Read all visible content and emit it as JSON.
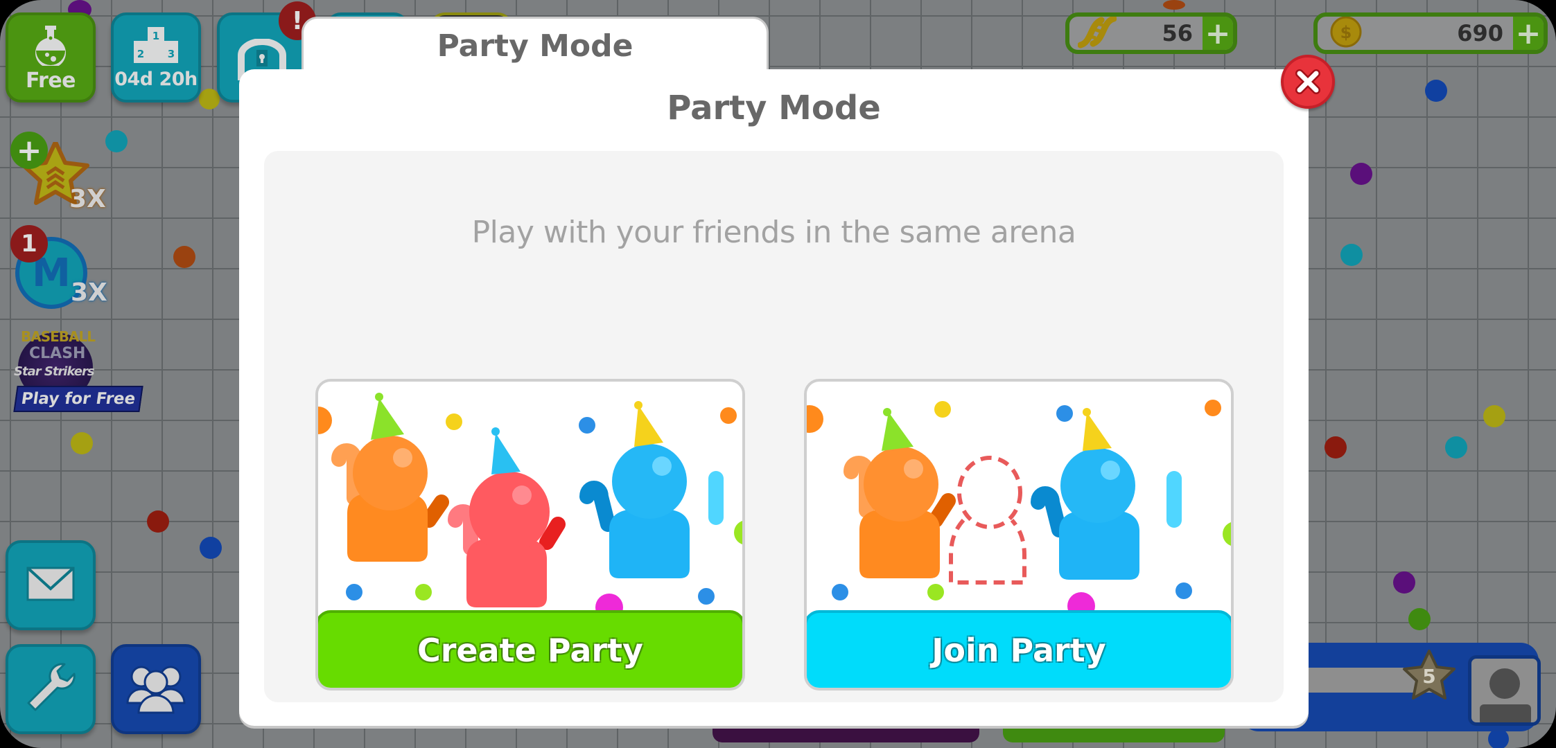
{
  "hud": {
    "top_left_buttons": [
      {
        "id": "free",
        "label": "Free",
        "icon": "flask-icon"
      },
      {
        "id": "leaderboard",
        "label": "04d 20h",
        "icon": "podium-icon",
        "podium_digits": [
          "1",
          "2",
          "3"
        ]
      },
      {
        "id": "chest",
        "label": "",
        "icon": "chest-icon",
        "badge": "!"
      }
    ],
    "currencies": [
      {
        "id": "dna",
        "icon": "dna-icon",
        "value": "56",
        "plus": "+"
      },
      {
        "id": "coins",
        "icon": "coin-icon",
        "value": "690",
        "plus": "+"
      }
    ],
    "boosts": [
      {
        "id": "xp-boost",
        "icon": "star-chevron-icon",
        "multiplier": "3X",
        "badge": "+"
      },
      {
        "id": "mass-boost",
        "icon": "m-coin-icon",
        "letter": "M",
        "multiplier": "3X",
        "badge": "1"
      }
    ],
    "ad": {
      "line1": "BASEBALL",
      "line2": "CLASH",
      "line3": "Star Strikers",
      "button": "Play for Free"
    },
    "bottom_left_buttons": [
      {
        "id": "mail",
        "icon": "mail-icon"
      },
      {
        "id": "settings",
        "icon": "wrench-icon"
      },
      {
        "id": "friends",
        "icon": "group-icon"
      }
    ],
    "player": {
      "level": "5",
      "level_progress": 0
    }
  },
  "modal": {
    "tab_title": "Party Mode",
    "title": "Party Mode",
    "subtitle": "Play with your friends in the same arena",
    "close_icon": "close-icon",
    "options": [
      {
        "id": "create",
        "label": "Create Party",
        "color": "#67dc00"
      },
      {
        "id": "join",
        "label": "Join Party",
        "color": "#00dcfb"
      }
    ]
  },
  "colors": {
    "close_red": "#e8333b",
    "hud_green": "#4b9411",
    "hud_teal": "#0f8fa1",
    "hud_navy": "#13409a",
    "title_gray": "#686868",
    "subtitle_gray": "#a2a2a2"
  }
}
